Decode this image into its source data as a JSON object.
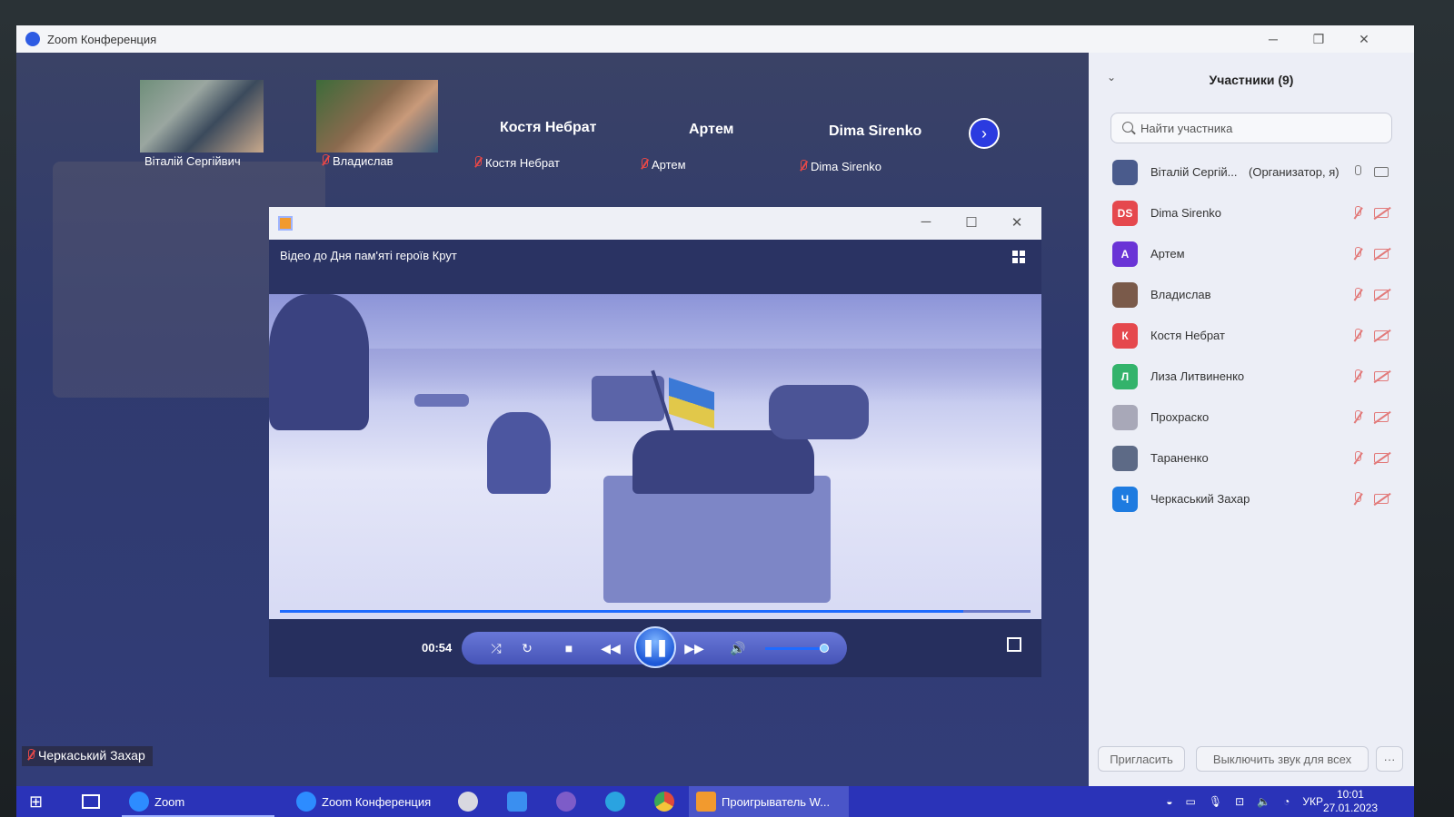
{
  "zoom_window": {
    "title": "Zoom Конференция"
  },
  "video_strip": {
    "tiles": [
      {
        "name": "Віталій Сергійвич"
      },
      {
        "name": "Владислав"
      },
      {
        "big_name": "Костя Небрат",
        "name": "Костя Небрат"
      },
      {
        "big_name": "Артем",
        "name": "Артем"
      },
      {
        "big_name": "Dima Sirenko",
        "name": "Dima Sirenko"
      }
    ],
    "next_icon": "chevron-right-icon"
  },
  "player": {
    "caption": "Відео до Дня пам'яті героїв Крут",
    "time": "00:54",
    "progress": 0.91,
    "volume": 0.95
  },
  "self_label": "Черкаський Захар",
  "participants": {
    "title": "Участники (9)",
    "search_placeholder": "Найти участника",
    "items": [
      {
        "name": "Віталій Сергій...",
        "role": "(Организатор, я)",
        "initials": "",
        "color": "#4a5b8c",
        "mic": "on",
        "cam": "on"
      },
      {
        "name": "Dima Sirenko",
        "initials": "DS",
        "color": "#e5484d",
        "mic": "off",
        "cam": "off"
      },
      {
        "name": "Артем",
        "initials": "А",
        "color": "#6a34d6",
        "mic": "off",
        "cam": "off"
      },
      {
        "name": "Владислав",
        "initials": "",
        "color": "#7a5a4a",
        "mic": "off",
        "cam": "off"
      },
      {
        "name": "Костя Небрат",
        "initials": "К",
        "color": "#e5484d",
        "mic": "off",
        "cam": "off"
      },
      {
        "name": "Лиза Литвиненко",
        "initials": "Л",
        "color": "#33b36b",
        "mic": "off",
        "cam": "off"
      },
      {
        "name": "Прохраско",
        "initials": "",
        "color": "#a8a8b8",
        "mic": "off",
        "cam": "off"
      },
      {
        "name": "Тараненко",
        "initials": "",
        "color": "#5d6a86",
        "mic": "off",
        "cam": "off"
      },
      {
        "name": "Черкаський Захар",
        "initials": "Ч",
        "color": "#1e7be0",
        "mic": "off",
        "cam": "off"
      }
    ],
    "invite_label": "Пригласить",
    "mute_all_label": "Выключить звук для всех",
    "more_label": "···"
  },
  "taskbar": {
    "zoom_label": "Zoom",
    "zoom_meeting_label": "Zoom Конференция",
    "player_label": "Проигрыватель W...",
    "lang": "УКР",
    "time": "10:01",
    "date": "27.01.2023"
  }
}
